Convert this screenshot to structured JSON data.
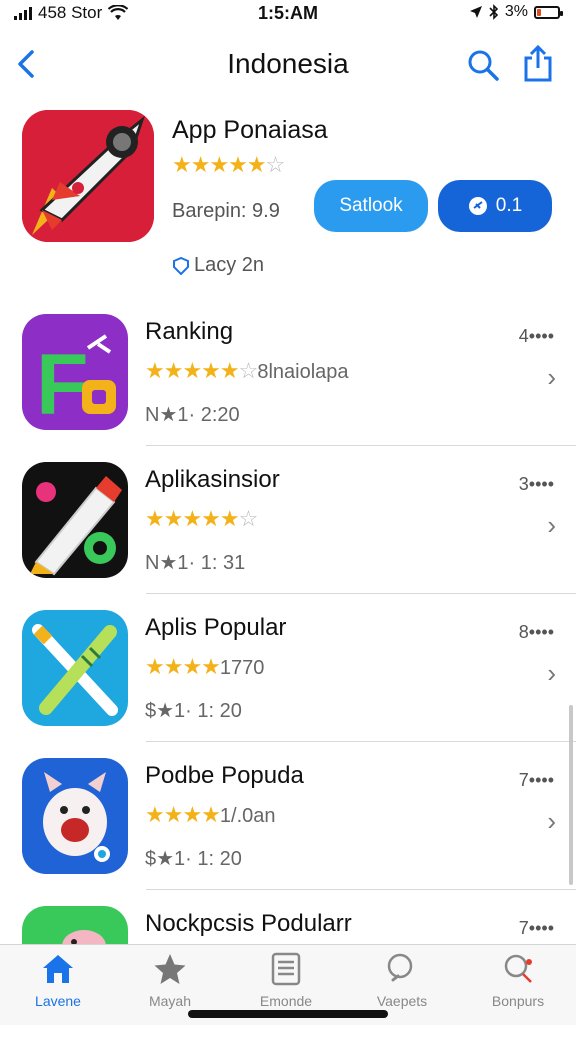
{
  "status_bar": {
    "carrier": "458 Stor",
    "time": "1:5:AM",
    "battery_percent": "3%",
    "battery_level": 0.2
  },
  "nav": {
    "title": "Indonesia"
  },
  "featured": {
    "name": "App Ponaiasa",
    "stars": "★★★★★",
    "empty_star": "☆",
    "meta": "Barepin: 9.9",
    "sub_label": "Lacy 2n",
    "button_light": "Satlook",
    "button_dark": "0.1"
  },
  "list": [
    {
      "name": "Ranking",
      "rank": "4••••",
      "stars": "★★★★★",
      "empty": "☆",
      "stars_text": "8lnaiolapa",
      "meta": "N★1· 2:20"
    },
    {
      "name": "Aplikasinsior",
      "rank": "3••••",
      "stars": "★★★★★",
      "empty": "☆",
      "stars_text": "",
      "meta": "N★1· 1: 31"
    },
    {
      "name": "Aplis Popular",
      "rank": "8••••",
      "stars": "★★★★",
      "empty": "",
      "stars_text": "1770",
      "meta": "$★1· 1: 20"
    },
    {
      "name": "Podbe Popuda",
      "rank": "7••••",
      "stars": "★★★★",
      "empty": "",
      "stars_text": "1/.0an",
      "meta": "$★1· 1: 20"
    },
    {
      "name": "Nockpcsis Podularr",
      "rank": "7••••",
      "stars": "",
      "empty": "",
      "stars_text": "",
      "meta": ""
    }
  ],
  "tabs": [
    {
      "label": "Lavene",
      "icon": "home-icon",
      "active": true
    },
    {
      "label": "Mayah",
      "icon": "star-icon",
      "active": false
    },
    {
      "label": "Emonde",
      "icon": "list-icon",
      "active": false
    },
    {
      "label": "Vaepets",
      "icon": "search-icon",
      "active": false
    },
    {
      "label": "Bonpurs",
      "icon": "profile-icon",
      "active": false
    }
  ],
  "colors": {
    "accent": "#1a73e8",
    "button_light": "#2a9bef",
    "button_dark": "#1565d8",
    "star": "#f3b21a"
  }
}
